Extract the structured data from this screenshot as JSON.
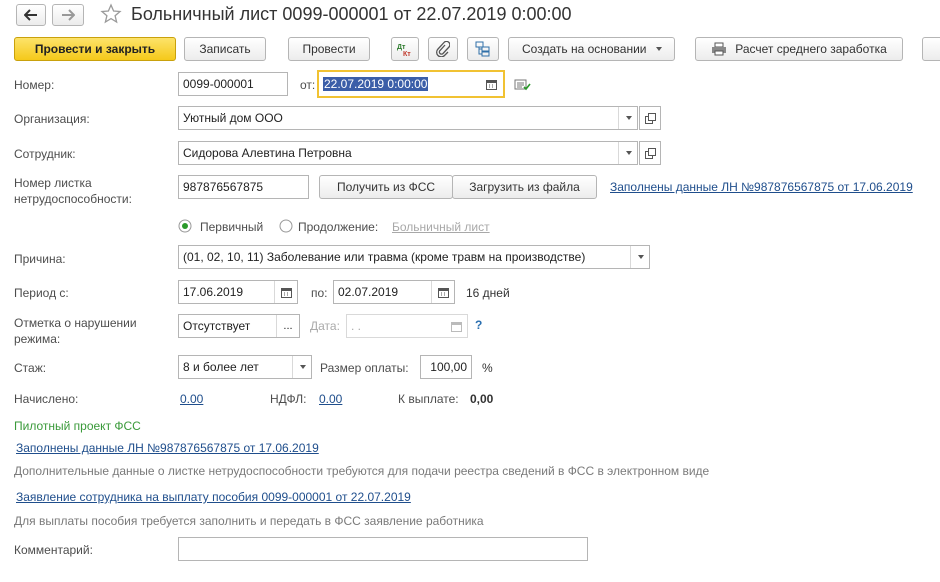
{
  "window": {
    "title": "Больничный лист 0099-000001 от 22.07.2019 0:00:00"
  },
  "toolbar": {
    "post_close": "Провести и закрыть",
    "save": "Записать",
    "post": "Провести",
    "dtkt": "Дт Кт",
    "create_based": "Создать на основании",
    "avg_salary": "Расчет среднего заработка"
  },
  "form": {
    "number_label": "Номер:",
    "number_value": "0099-000001",
    "from_label": "от:",
    "date_value": "22.07.2019  0:00:00",
    "org_label": "Организация:",
    "org_value": "Уютный дом ООО",
    "employee_label": "Сотрудник:",
    "employee_value": "Сидорова Алевтина Петровна",
    "sheet_label_1": "Номер листка",
    "sheet_label_2": "нетрудоспособности:",
    "sheet_value": "987876567875",
    "get_fss": "Получить из ФСС",
    "load_file": "Загрузить из файла",
    "filled_link": "Заполнены данные ЛН №987876567875 от 17.06.2019",
    "primary_label": "Первичный",
    "continuation_label": "Продолжение:",
    "continuation_placeholder": "Больничный лист",
    "reason_label": "Причина:",
    "reason_value": "(01, 02, 10, 11) Заболевание или травма (кроме травм на производстве)",
    "period_label": "Период с:",
    "period_from": "17.06.2019",
    "period_to_label": "по:",
    "period_to": "02.07.2019",
    "days": "16 дней",
    "violation_label_1": "Отметка о нарушении",
    "violation_label_2": "режима:",
    "violation_value": "Отсутствует",
    "date_label": "Дата:",
    "date_placeholder": " .  .",
    "help": "?",
    "exp_label": "Стаж:",
    "exp_value": "8 и более лет",
    "pay_label": "Размер оплаты:",
    "pay_value": "100,00",
    "pay_unit": "%",
    "accrued_label": "Начислено:",
    "accrued_value": "0.00",
    "ndfl_label": "НДФЛ:",
    "ndfl_value": "0.00",
    "topay_label": "К выплате:",
    "topay_value": "0,00"
  },
  "fss": {
    "pilot": "Пилотный проект ФСС",
    "filled_link": "Заполнены данные ЛН №987876567875 от 17.06.2019",
    "note1": "Дополнительные данные о листке нетрудоспособности требуются для подачи реестра сведений в ФСС в электронном виде",
    "application_link": "Заявление сотрудника на выплату пособия 0099-000001 от 22.07.2019",
    "note2": "Для выплаты пособия требуется заполнить и передать в ФСС заявление работника"
  },
  "comment": {
    "label": "Комментарий:",
    "value": ""
  },
  "colors": {
    "accent": "#f5c91a",
    "link": "#1f4e8c",
    "pilot": "#3a9a3a"
  }
}
